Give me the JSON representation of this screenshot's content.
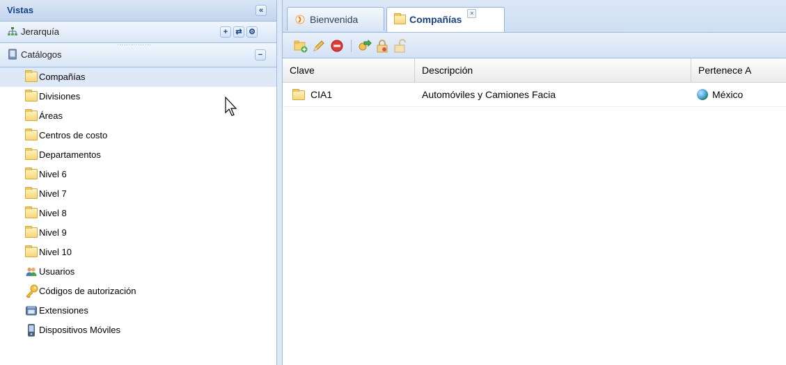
{
  "west": {
    "title": "Vistas",
    "collapse_glyph": "«",
    "jerarquia": {
      "label": "Jerarquía",
      "icon": "hierarchy-icon",
      "tools": [
        "+",
        "⇄",
        "⚙"
      ]
    },
    "catalogos": {
      "label": "Catálogos",
      "icon": "book-icon",
      "collapse_glyph": "−",
      "items": [
        {
          "label": "Compañías",
          "icon": "folder-icon",
          "selected": true
        },
        {
          "label": "Divisiones",
          "icon": "folder-icon"
        },
        {
          "label": "Áreas",
          "icon": "folder-icon"
        },
        {
          "label": "Centros de costo",
          "icon": "folder-icon"
        },
        {
          "label": "Departamentos",
          "icon": "folder-icon"
        },
        {
          "label": "Nivel 6",
          "icon": "folder-icon"
        },
        {
          "label": "Nivel 7",
          "icon": "folder-icon"
        },
        {
          "label": "Nivel 8",
          "icon": "folder-icon"
        },
        {
          "label": "Nivel 9",
          "icon": "folder-icon"
        },
        {
          "label": "Nivel 10",
          "icon": "folder-icon"
        },
        {
          "label": "Usuarios",
          "icon": "users-icon"
        },
        {
          "label": "Códigos de autorización",
          "icon": "key-icon"
        },
        {
          "label": "Extensiones",
          "icon": "phone-icon"
        },
        {
          "label": "Dispositivos Móviles",
          "icon": "mobile-icon"
        }
      ]
    }
  },
  "tabs": [
    {
      "label": "Bienvenida",
      "icon": "welcome-icon",
      "active": false
    },
    {
      "label": "Compañías",
      "icon": "folder-icon",
      "active": true,
      "close_glyph": "×"
    }
  ],
  "toolbar": {
    "buttons": [
      "add-folder-icon",
      "edit-pencil-icon",
      "delete-icon",
      "move-icon",
      "lock-icon",
      "unlock-icon"
    ]
  },
  "grid": {
    "columns": [
      "Clave",
      "Descripción",
      "Pertenece A"
    ],
    "rows": [
      {
        "clave": "CIA1",
        "descripcion": "Automóviles y Camiones Facia",
        "pertenece": "México"
      }
    ]
  },
  "colors": {
    "header_text": "#15428b",
    "border": "#99bbe8",
    "selected_row": "#dfe8f6"
  }
}
